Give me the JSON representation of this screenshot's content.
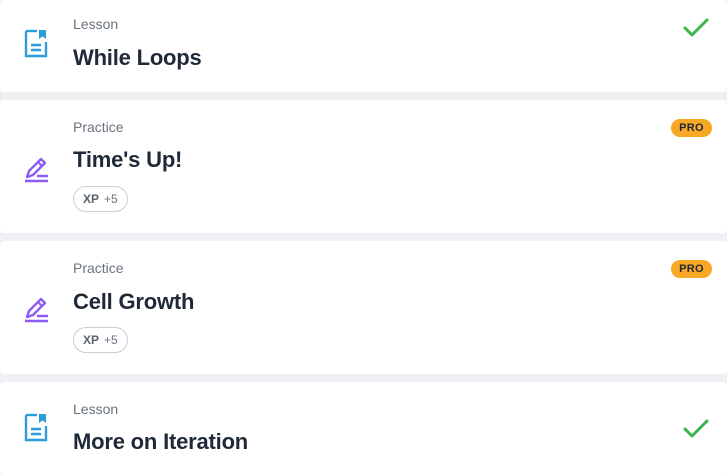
{
  "colors": {
    "lesson_icon": "#2d9cdb",
    "practice_icon": "#8b5cf6",
    "check": "#3bb54a",
    "pro_badge": "#f9a825"
  },
  "items": [
    {
      "type": "Lesson",
      "title": "While Loops",
      "icon": "document-icon",
      "status": "completed",
      "status_icon": "checkmark-icon"
    },
    {
      "type": "Practice",
      "title": "Time's Up!",
      "icon": "pencil-icon",
      "badge": "PRO",
      "xp_label": "XP",
      "xp_value": "+5"
    },
    {
      "type": "Practice",
      "title": "Cell Growth",
      "icon": "pencil-icon",
      "badge": "PRO",
      "xp_label": "XP",
      "xp_value": "+5"
    },
    {
      "type": "Lesson",
      "title": "More on Iteration",
      "icon": "document-icon",
      "status": "completed",
      "status_icon": "checkmark-icon"
    }
  ]
}
